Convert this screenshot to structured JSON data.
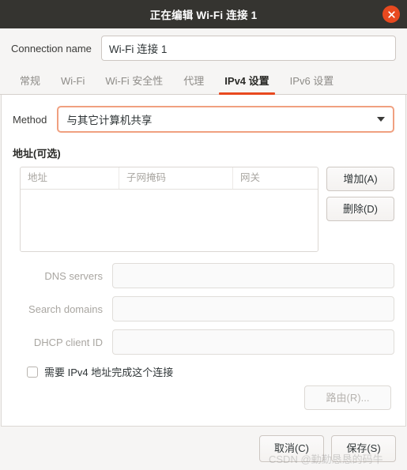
{
  "window": {
    "title": "正在编辑 Wi-Fi 连接 1",
    "close_icon": "close-icon",
    "accent_color": "#e8491f",
    "titlebar_color": "#353430"
  },
  "connection": {
    "label": "Connection name",
    "value": "Wi-Fi 连接 1",
    "placeholder": ""
  },
  "tabs": [
    {
      "label": "常规",
      "active": false
    },
    {
      "label": "Wi-Fi",
      "active": false
    },
    {
      "label": "Wi-Fi 安全性",
      "active": false
    },
    {
      "label": "代理",
      "active": false
    },
    {
      "label": "IPv4 设置",
      "active": true
    },
    {
      "label": "IPv6 设置",
      "active": false
    }
  ],
  "method": {
    "label": "Method",
    "value": "与其它计算机共享",
    "arrow_icon": "chevron-down-icon"
  },
  "addresses": {
    "section_title": "地址(可选)",
    "columns": [
      "地址",
      "子网掩码",
      "网关"
    ],
    "rows": [],
    "add_button": "增加(A)",
    "delete_button": "删除(D)"
  },
  "fields": [
    {
      "label": "DNS servers",
      "value": "",
      "placeholder": "",
      "disabled": true
    },
    {
      "label": "Search domains",
      "value": "",
      "placeholder": "",
      "disabled": true
    },
    {
      "label": "DHCP client ID",
      "value": "",
      "placeholder": "",
      "disabled": true
    }
  ],
  "require_ipv4": {
    "label": "需要 IPv4 地址完成这个连接",
    "checked": false
  },
  "routes": {
    "label": "路由(R)...",
    "disabled": true
  },
  "footer": {
    "cancel": "取消(C)",
    "save": "保存(S)"
  },
  "watermark": {
    "text": "CSDN @勤勤恳恳的码牛"
  }
}
